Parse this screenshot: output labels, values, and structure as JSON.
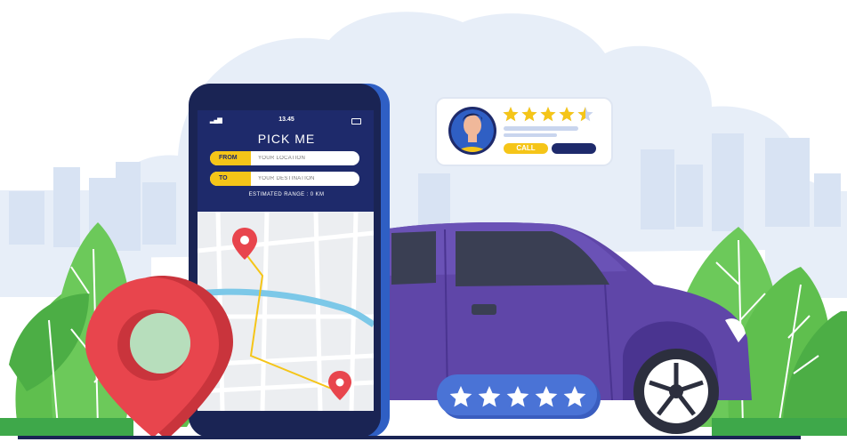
{
  "phone": {
    "status_time": "13.45",
    "title": "PICK ME",
    "from_label": "FROM",
    "from_placeholder": "YOUR LOCATION",
    "to_label": "TO",
    "to_placeholder": "YOUR DESTINATION",
    "range_text": "ESTIMATED RANGE : 0 KM"
  },
  "driver_card": {
    "rating": 4.5,
    "max_rating": 5,
    "call_label": "CALL"
  },
  "rating_badge": {
    "stars": 5
  },
  "icons": [
    "location-pin-icon",
    "map-marker-icon",
    "star-icon",
    "signal-icon",
    "battery-icon",
    "avatar-icon"
  ],
  "colors": {
    "phone_header": "#1e2a6b",
    "accent_yellow": "#f5c518",
    "car_body": "#5f46a8",
    "pin_red": "#e8454d",
    "badge_blue": "#4a73d6",
    "leaf_green": "#5fbf4e",
    "sky": "#e7eef8"
  }
}
